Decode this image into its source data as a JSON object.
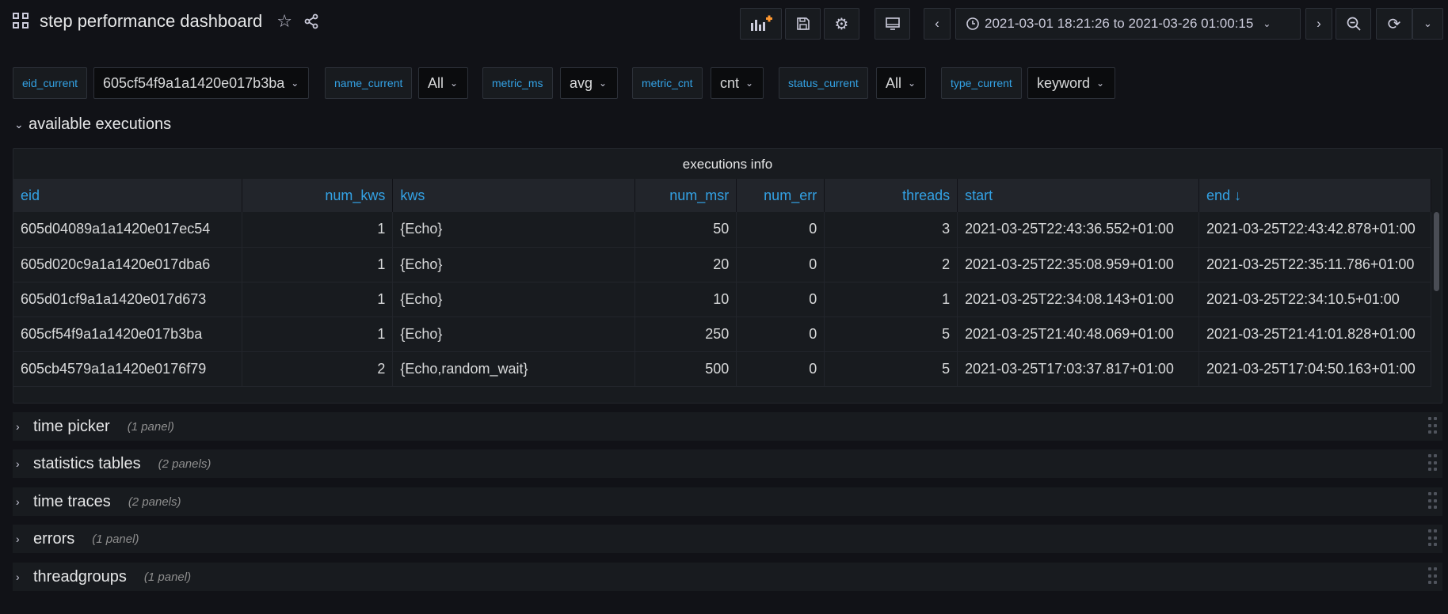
{
  "header": {
    "title": "step performance dashboard",
    "time_range": "2021-03-01 18:21:26 to 2021-03-26 01:00:15",
    "icons": [
      "dashboard-grid-icon",
      "star-icon",
      "share-icon",
      "add-panel-icon",
      "save-icon",
      "gear-icon",
      "tv-icon",
      "chevron-left-icon",
      "clock-icon",
      "chevron-right-icon",
      "zoom-out-icon",
      "refresh-icon",
      "chevron-down-icon"
    ]
  },
  "variables": [
    {
      "label": "eid_current",
      "value": "605cf54f9a1a1420e017b3ba"
    },
    {
      "label": "name_current",
      "value": "All"
    },
    {
      "label": "metric_ms",
      "value": "avg"
    },
    {
      "label": "metric_cnt",
      "value": "cnt"
    },
    {
      "label": "status_current",
      "value": "All"
    },
    {
      "label": "type_current",
      "value": "keyword"
    }
  ],
  "open_row": {
    "title": "available executions"
  },
  "panel": {
    "title": "executions info",
    "columns": [
      "eid",
      "num_kws",
      "kws",
      "num_msr",
      "num_err",
      "threads",
      "start",
      "end"
    ],
    "sort_indicator": "↓",
    "rows": [
      [
        "605d04089a1a1420e017ec54",
        "1",
        "{Echo}",
        "50",
        "0",
        "3",
        "2021-03-25T22:43:36.552+01:00",
        "2021-03-25T22:43:42.878+01:00"
      ],
      [
        "605d020c9a1a1420e017dba6",
        "1",
        "{Echo}",
        "20",
        "0",
        "2",
        "2021-03-25T22:35:08.959+01:00",
        "2021-03-25T22:35:11.786+01:00"
      ],
      [
        "605d01cf9a1a1420e017d673",
        "1",
        "{Echo}",
        "10",
        "0",
        "1",
        "2021-03-25T22:34:08.143+01:00",
        "2021-03-25T22:34:10.5+01:00"
      ],
      [
        "605cf54f9a1a1420e017b3ba",
        "1",
        "{Echo}",
        "250",
        "0",
        "5",
        "2021-03-25T21:40:48.069+01:00",
        "2021-03-25T21:41:01.828+01:00"
      ],
      [
        "605cb4579a1a1420e0176f79",
        "2",
        "{Echo,random_wait}",
        "500",
        "0",
        "5",
        "2021-03-25T17:03:37.817+01:00",
        "2021-03-25T17:04:50.163+01:00"
      ]
    ]
  },
  "collapsed_rows": [
    {
      "name": "time picker",
      "count": "(1 panel)"
    },
    {
      "name": "statistics tables",
      "count": "(2 panels)"
    },
    {
      "name": "time traces",
      "count": "(2 panels)"
    },
    {
      "name": "errors",
      "count": "(1 panel)"
    },
    {
      "name": "threadgroups",
      "count": "(1 panel)"
    }
  ]
}
